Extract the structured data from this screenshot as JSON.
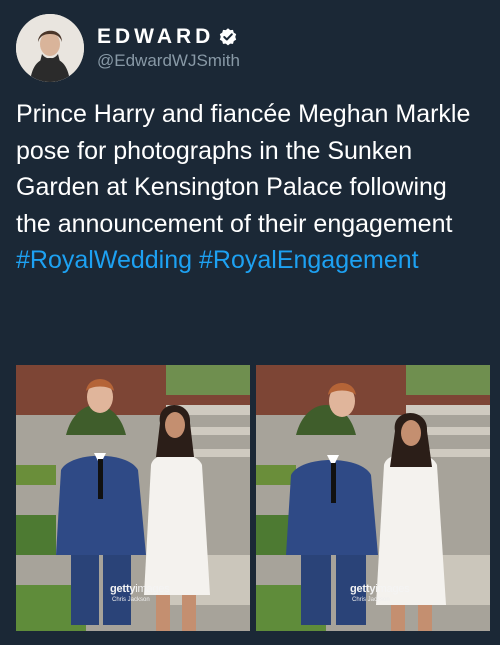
{
  "author": {
    "display_name": "EDWARD",
    "handle": "@EdwardWJSmith",
    "verified": true,
    "avatar_icon": "profile-photo"
  },
  "tweet": {
    "text": "Prince Harry and fiancée Meghan Markle pose for photographs in the Sunken Garden at Kensington Palace following the announcement of their engagement",
    "hashtags": [
      "#RoyalWedding",
      "#RoyalEngagement"
    ]
  },
  "media": {
    "photos": [
      {
        "watermark_brand": "getty",
        "watermark_suffix": "images",
        "credit": "Chris Jackson"
      },
      {
        "watermark_brand": "getty",
        "watermark_suffix": "images",
        "credit": "Chris Jackson"
      }
    ]
  },
  "colors": {
    "background": "#1b2836",
    "hashtag": "#1da1f2",
    "handle": "#8899a6",
    "verified_badge": "#ffffff"
  }
}
